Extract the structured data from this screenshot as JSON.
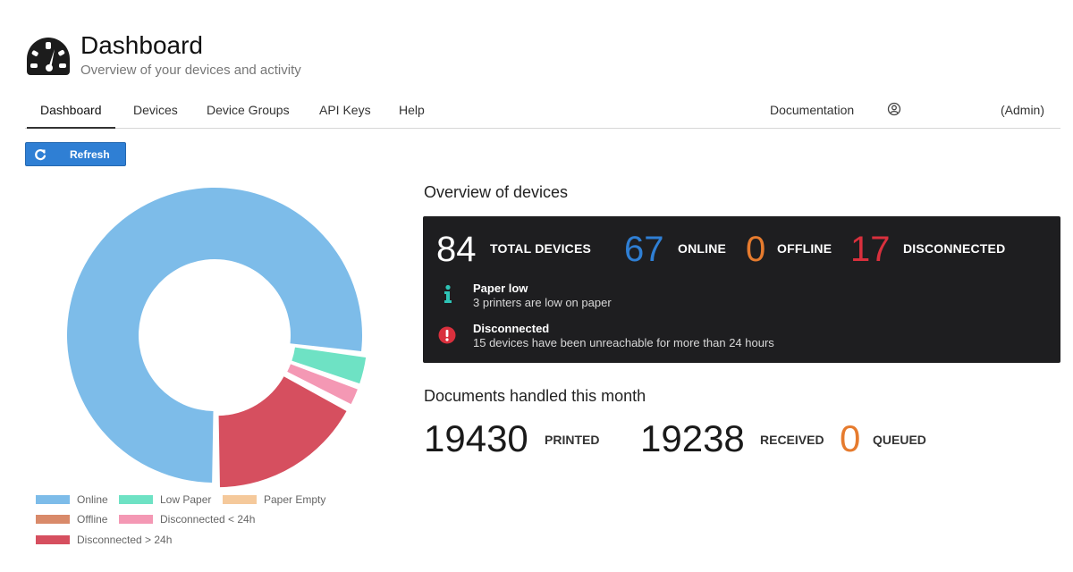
{
  "header": {
    "title": "Dashboard",
    "subtitle": "Overview of your devices and activity",
    "logo_icon": "speedometer-icon"
  },
  "nav": {
    "items": [
      "Dashboard",
      "Devices",
      "Device Groups",
      "API Keys",
      "Help"
    ],
    "active": "Dashboard",
    "documentation": "Documentation",
    "user_icon": "user-circle-icon",
    "admin": "(Admin)"
  },
  "refresh": {
    "label": "Refresh",
    "icon": "refresh-icon",
    "color": "#2f7fd4"
  },
  "chart_data": {
    "type": "pie",
    "donut": true,
    "categories": [
      "Online",
      "Low Paper",
      "Paper Empty",
      "Offline",
      "Disconnected < 24h",
      "Disconnected > 24h"
    ],
    "values": [
      67,
      3,
      0,
      0,
      2,
      15
    ],
    "colors": [
      "#7dbce9",
      "#6ee2c4",
      "#f5c99b",
      "#d98a6a",
      "#f498b4",
      "#d64f5f"
    ],
    "legend_position": "bottom-left"
  },
  "overview": {
    "title": "Overview of devices",
    "total": {
      "value": "84",
      "label": "TOTAL DEVICES",
      "color": "#ffffff"
    },
    "online": {
      "value": "67",
      "label": "ONLINE",
      "color": "#2f7fd4"
    },
    "offline": {
      "value": "0",
      "label": "OFFLINE",
      "color": "#e67b2e"
    },
    "disconnected": {
      "value": "17",
      "label": "DISCONNECTED",
      "color": "#d9303d"
    },
    "alerts": [
      {
        "icon": "info-icon",
        "title": "Paper low",
        "text": "3 printers are low on paper",
        "color": "#2ec4b6"
      },
      {
        "icon": "exclamation-circle-icon",
        "title": "Disconnected",
        "text": "15 devices have been unreachable for more than 24 hours",
        "color": "#d9303d"
      }
    ]
  },
  "documents": {
    "title": "Documents handled this month",
    "printed": {
      "value": "19430",
      "label": "PRINTED"
    },
    "received": {
      "value": "19238",
      "label": "RECEIVED"
    },
    "queued": {
      "value": "0",
      "label": "QUEUED",
      "color": "#e67b2e"
    }
  }
}
